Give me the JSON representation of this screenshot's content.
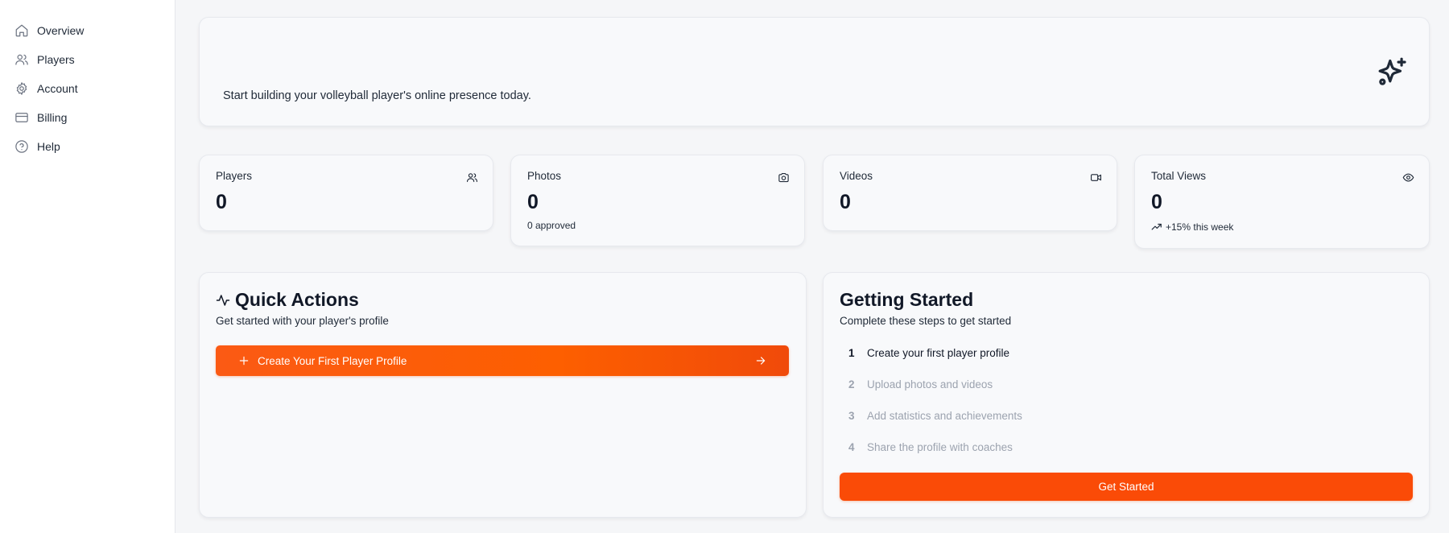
{
  "sidebar": {
    "items": [
      {
        "label": "Overview",
        "icon": "home-icon"
      },
      {
        "label": "Players",
        "icon": "users-icon"
      },
      {
        "label": "Account",
        "icon": "gear-icon"
      },
      {
        "label": "Billing",
        "icon": "credit-card-icon"
      },
      {
        "label": "Help",
        "icon": "help-circle-icon"
      }
    ]
  },
  "hero": {
    "text": "Start building your volleyball player's online presence today.",
    "icon": "sparkles-icon"
  },
  "stats": [
    {
      "label": "Players",
      "value": "0",
      "sub": "",
      "icon": "users-icon"
    },
    {
      "label": "Photos",
      "value": "0",
      "sub": "0 approved",
      "icon": "camera-icon"
    },
    {
      "label": "Videos",
      "value": "0",
      "sub": "",
      "icon": "video-icon"
    },
    {
      "label": "Total Views",
      "value": "0",
      "sub": "+15% this week",
      "icon": "eye-icon",
      "sub_icon": "trending-up-icon"
    }
  ],
  "quick_actions": {
    "title": "Quick Actions",
    "subtitle": "Get started with your player's profile",
    "button_label": "Create Your First Player Profile"
  },
  "getting_started": {
    "title": "Getting Started",
    "subtitle": "Complete these steps to get started",
    "steps": [
      {
        "num": "1",
        "label": "Create your first player profile",
        "active": true
      },
      {
        "num": "2",
        "label": "Upload photos and videos",
        "active": false
      },
      {
        "num": "3",
        "label": "Add statistics and achievements",
        "active": false
      },
      {
        "num": "4",
        "label": "Share the profile with coaches",
        "active": false
      }
    ],
    "button_label": "Get Started"
  },
  "colors": {
    "accent": "#fa4b07",
    "inactive_text": "#9ca3af"
  }
}
